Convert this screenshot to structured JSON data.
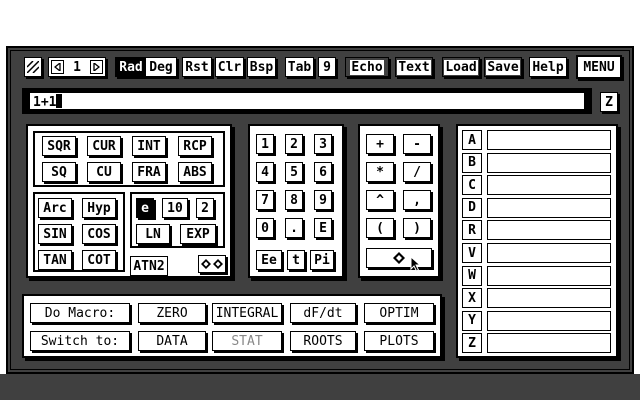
{
  "toolbar": {
    "page_value": "1",
    "rad": "Rad",
    "deg": "Deg",
    "rst": "Rst",
    "clr": "Clr",
    "bsp": "Bsp",
    "tab": "Tab",
    "tab_value": "9",
    "echo": "Echo",
    "text": "Text",
    "load": "Load",
    "save": "Save",
    "help": "Help",
    "menu": "MENU"
  },
  "expression": {
    "value": "1+1",
    "side_button": "Z"
  },
  "functions": {
    "row1": [
      "SQR",
      "CUR",
      "INT",
      "RCP"
    ],
    "row2": [
      "SQ",
      "CU",
      "FRA",
      "ABS"
    ],
    "arc": "Arc",
    "hyp": "Hyp",
    "sin": "SIN",
    "cos": "COS",
    "tan": "TAN",
    "cot": "COT",
    "e": "e",
    "ten": "10",
    "two": "2",
    "ln": "LN",
    "exp": "EXP",
    "atn2": "ATN2"
  },
  "numpad": {
    "keys": [
      "1",
      "2",
      "3",
      "4",
      "5",
      "6",
      "7",
      "8",
      "9",
      "0",
      ".",
      "E"
    ],
    "ee": "Ee",
    "t": "t",
    "pi": "Pi"
  },
  "operators": [
    "+",
    "-",
    "*",
    "/",
    "^",
    ",",
    "(",
    ")"
  ],
  "variables": [
    "A",
    "B",
    "C",
    "D",
    "R",
    "V",
    "W",
    "X",
    "Y",
    "Z"
  ],
  "macro": {
    "do_macro": "Do Macro:",
    "switch_to": "Switch to:",
    "row1": [
      "ZERO",
      "INTEGRAL",
      "dF/dt",
      "OPTIM"
    ],
    "row2": [
      "DATA",
      "STAT",
      "ROOTS",
      "PLOTS"
    ]
  }
}
